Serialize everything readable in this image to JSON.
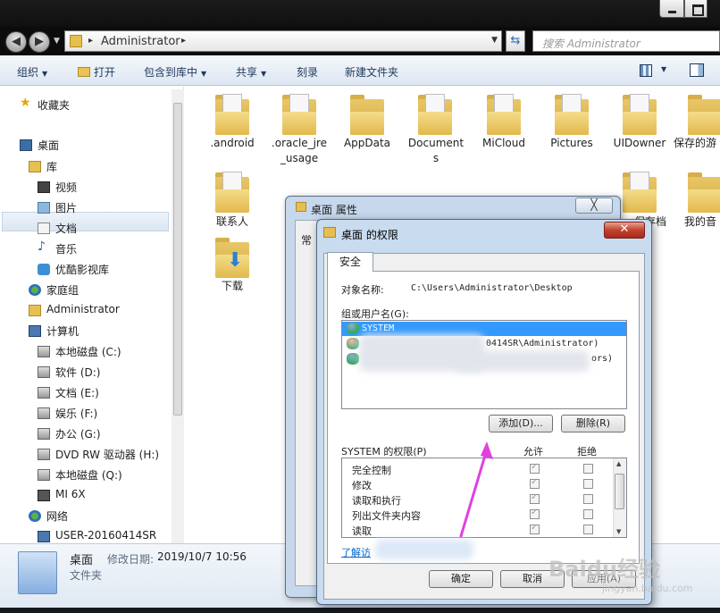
{
  "explorer": {
    "address": {
      "path": "Administrator",
      "separator": "▸"
    },
    "search_placeholder": "搜索 Administrator",
    "toolbar": {
      "organize": "组织",
      "open": "打开",
      "include_in_library": "包含到库中",
      "share": "共享",
      "burn": "刻录",
      "new_folder": "新建文件夹"
    },
    "nav": {
      "favorites": "收藏夹",
      "desktop": "桌面",
      "libraries": "库",
      "videos": "视频",
      "pictures": "图片",
      "documents": "文档",
      "music": "音乐",
      "youku": "优酷影视库",
      "homegroup": "家庭组",
      "administrator": "Administrator",
      "computer": "计算机",
      "drive_c": "本地磁盘 (C:)",
      "drive_d": "软件 (D:)",
      "drive_e": "文档 (E:)",
      "drive_f": "娱乐 (F:)",
      "drive_g": "办公 (G:)",
      "drive_h": "DVD RW 驱动器 (H:)",
      "drive_q": "本地磁盘 (Q:)",
      "mi6x": "MI 6X",
      "network": "网络",
      "network_pc": "USER-20160414SR"
    },
    "folders": [
      {
        "line1": ".android",
        "line2": ""
      },
      {
        "line1": ".oracle_jre",
        "line2": "_usage"
      },
      {
        "line1": "AppData",
        "line2": ""
      },
      {
        "line1": "Document",
        "line2": "s"
      },
      {
        "line1": "MiCloud",
        "line2": ""
      },
      {
        "line1": "Pictures",
        "line2": ""
      },
      {
        "line1": "UIDowner",
        "line2": ""
      },
      {
        "line1": "保存的游",
        "line2": ""
      },
      {
        "line1": "联系人",
        "line2": ""
      },
      {
        "line1": "下载",
        "line2": ""
      },
      {
        "line1": "保存档",
        "line2": ""
      },
      {
        "line1": "我的音",
        "line2": ""
      }
    ],
    "status": {
      "name": "桌面",
      "modified_label": "修改日期:",
      "modified_value": "2019/10/7 10:56",
      "type": "文件夹"
    }
  },
  "properties_dialog": {
    "title": "桌面 属性",
    "close": "╳",
    "tab_fragment": "常"
  },
  "permissions_dialog": {
    "title": "桌面 的权限",
    "close": "✕",
    "tab": "安全",
    "object_label": "对象名称:",
    "object_value": "C:\\Users\\Administrator\\Desktop",
    "group_label": "组或用户名(G):",
    "users": [
      {
        "name": "SYSTEM",
        "selected": true
      },
      {
        "name": "0414SR\\Administrator)",
        "selected": false
      },
      {
        "name": "ors)",
        "selected": false
      }
    ],
    "add_button": "添加(D)...",
    "remove_button": "删除(R)",
    "perm_header": "SYSTEM 的权限(P)",
    "allow_header": "允许",
    "deny_header": "拒绝",
    "permissions": [
      {
        "name": "完全控制",
        "allow": true,
        "deny": false
      },
      {
        "name": "修改",
        "allow": true,
        "deny": false
      },
      {
        "name": "读取和执行",
        "allow": true,
        "deny": false
      },
      {
        "name": "列出文件夹内容",
        "allow": true,
        "deny": false
      },
      {
        "name": "读取",
        "allow": true,
        "deny": false
      }
    ],
    "learn_link": "了解访",
    "ok": "确定",
    "cancel": "取消",
    "apply": "应用(A)"
  },
  "colors": {
    "selection": "#3399ff",
    "annotation_arrow": "#e040e0",
    "close_red": "#c1432d"
  },
  "watermark": {
    "brand": "Baidu经验",
    "url": "jingyan.baidu.com"
  }
}
